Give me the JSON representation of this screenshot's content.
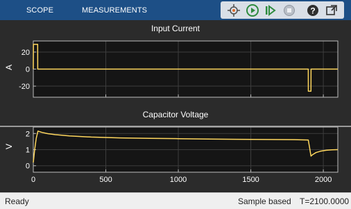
{
  "toolstrip": {
    "tabs": [
      "SCOPE",
      "MEASUREMENTS"
    ],
    "buttons": [
      {
        "name": "highlight-block-icon",
        "title": ""
      },
      {
        "name": "run-icon",
        "title": ""
      },
      {
        "name": "step-forward-icon",
        "title": ""
      },
      {
        "name": "stop-icon",
        "title": ""
      },
      {
        "name": "help-icon",
        "title": ""
      },
      {
        "name": "undock-icon",
        "title": ""
      }
    ],
    "colors": {
      "bar": "#1d4f86",
      "run": "#2e8b3e"
    }
  },
  "chart_data": [
    {
      "type": "line",
      "title": "Input Current",
      "ylabel": "A",
      "xlim": [
        0,
        2100
      ],
      "ylim": [
        -33,
        33
      ],
      "yticks": [
        20,
        0,
        -20
      ],
      "xticks": [
        0,
        500,
        1000,
        1500,
        2000
      ],
      "grid": true,
      "color": "#ffd75e",
      "series": [
        {
          "x": [
            0,
            1,
            30,
            30.5,
            1896,
            1896.5,
            1915,
            1915.5,
            2100
          ],
          "y": [
            0,
            29,
            29,
            0,
            0,
            -26,
            -26,
            0,
            0
          ]
        }
      ]
    },
    {
      "type": "line",
      "title": "Capacitor Voltage",
      "ylabel": "V",
      "xlim": [
        0,
        2100
      ],
      "ylim": [
        -0.4,
        2.4
      ],
      "yticks": [
        0,
        1,
        2
      ],
      "xticks": [
        0,
        500,
        1000,
        1500,
        2000
      ],
      "xticklabels": [
        "0",
        "500",
        "1000",
        "1500",
        "2000"
      ],
      "grid": true,
      "color": "#ffd75e",
      "series": [
        {
          "x": [
            0,
            8,
            20,
            32,
            60,
            100,
            150,
            250,
            400,
            600,
            800,
            1000,
            1200,
            1400,
            1600,
            1800,
            1896,
            1905,
            1915,
            1925,
            1950,
            1980,
            2020,
            2060,
            2100
          ],
          "y": [
            0.2,
            0.9,
            1.7,
            2.15,
            2.07,
            1.99,
            1.93,
            1.85,
            1.78,
            1.73,
            1.7,
            1.68,
            1.66,
            1.64,
            1.63,
            1.62,
            1.6,
            1.15,
            0.6,
            0.68,
            0.82,
            0.9,
            0.96,
            0.99,
            1.0
          ]
        }
      ]
    }
  ],
  "status": {
    "state": "Ready",
    "mode": "Sample based",
    "time": "T=2100.0000"
  }
}
